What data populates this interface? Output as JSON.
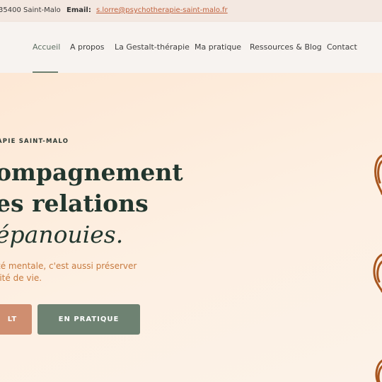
{
  "topbar": {
    "address": "35400 Saint-Malo",
    "email_label": "Email:",
    "email": "s.lorre@psychotherapie-saint-malo.fr"
  },
  "nav": {
    "items": [
      {
        "label": "Accueil",
        "active": true
      },
      {
        "label": "A propos"
      },
      {
        "label": "La Gestalt-thérapie"
      },
      {
        "label": "Ma pratique"
      },
      {
        "label": "Ressources & Blog"
      },
      {
        "label": "Contact"
      }
    ]
  },
  "hero": {
    "eyebrow": "APIE SAINT-MALO",
    "line1": "ompagnement",
    "line2": "es relations",
    "line3": "épanouies.",
    "sub1": "té mentale, c'est aussi préserver",
    "sub2": "lité de vie.",
    "btn_primary": "LT",
    "btn_secondary": "EN PRATIQUE"
  },
  "colors": {
    "accent_sage": "#6e8272",
    "accent_terracotta": "#cf8e70",
    "heading": "#22362e",
    "highlight": "#c77a3f",
    "deco": "#a8561f"
  }
}
